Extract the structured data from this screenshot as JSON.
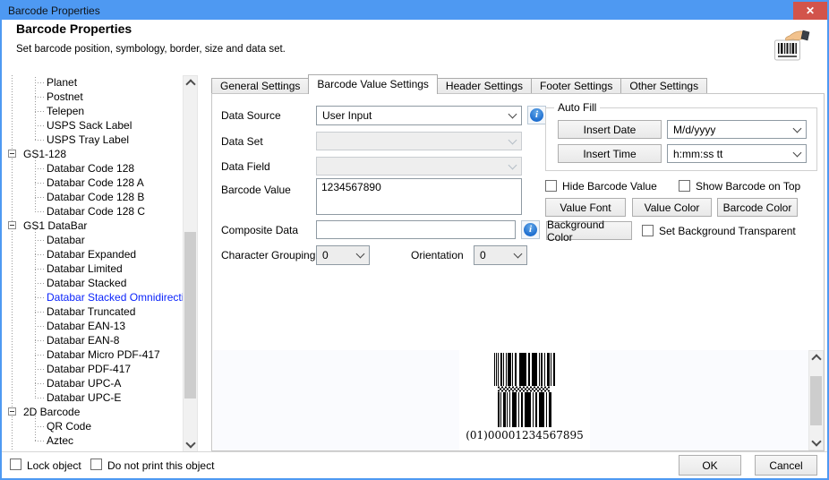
{
  "window": {
    "title": "Barcode Properties",
    "close": "✕"
  },
  "header": {
    "title": "Barcode Properties",
    "subtitle": "Set barcode position, symbology, border, size and data set."
  },
  "tree": {
    "top_children": [
      "Planet",
      "Postnet",
      "Telepen",
      "USPS Sack Label",
      "USPS Tray Label"
    ],
    "groups": [
      {
        "label": "GS1-128",
        "expanded": true,
        "children": [
          "Databar Code 128",
          "Databar Code 128 A",
          "Databar Code 128 B",
          "Databar Code 128 C"
        ]
      },
      {
        "label": "GS1 DataBar",
        "expanded": true,
        "children": [
          "Databar",
          "Databar Expanded",
          "Databar Limited",
          "Databar Stacked",
          "Databar Stacked Omnidirectional",
          "Databar Truncated",
          "Databar EAN-13",
          "Databar EAN-8",
          "Databar Micro PDF-417",
          "Databar PDF-417",
          "Databar UPC-A",
          "Databar UPC-E"
        ]
      },
      {
        "label": "2D Barcode",
        "expanded": true,
        "children": [
          "QR Code",
          "Aztec"
        ]
      }
    ],
    "selected_item": "Databar Stacked Omnidirectional"
  },
  "tabs": {
    "labels": [
      "General Settings",
      "Barcode Value Settings",
      "Header Settings",
      "Footer Settings",
      "Other Settings"
    ],
    "active": "Barcode Value Settings",
    "active_index": 1
  },
  "form": {
    "data_source_label": "Data Source",
    "data_source_value": "User Input",
    "data_set_label": "Data Set",
    "data_set_value": "",
    "data_field_label": "Data Field",
    "data_field_value": "",
    "barcode_value_label": "Barcode Value",
    "barcode_value": "1234567890",
    "composite_data_label": "Composite Data",
    "composite_data_value": "",
    "character_grouping_label": "Character Grouping",
    "character_grouping_value": "0",
    "orientation_label": "Orientation",
    "orientation_value": "0"
  },
  "auto_fill": {
    "title": "Auto Fill",
    "insert_date_label": "Insert Date",
    "date_format_value": "M/d/yyyy",
    "insert_time_label": "Insert Time",
    "time_format_value": "h:mm:ss tt"
  },
  "value_options": {
    "hide_barcode_value_label": "Hide Barcode Value",
    "hide_barcode_value_checked": false,
    "show_barcode_on_top_label": "Show Barcode on Top",
    "show_barcode_on_top_checked": false,
    "value_font_label": "Value Font",
    "value_color_label": "Value Color",
    "barcode_color_label": "Barcode Color",
    "background_color_label": "Background Color",
    "set_background_transparent_label": "Set Background Transparent",
    "set_background_transparent_checked": false
  },
  "preview": {
    "caption": "(01)00001234567895"
  },
  "footer": {
    "lock_object_label": "Lock object",
    "lock_object_checked": false,
    "do_not_print_label": "Do not print this object",
    "do_not_print_checked": false,
    "ok_label": "OK",
    "cancel_label": "Cancel"
  },
  "colors": {
    "titlebar_blue": "#4e99f2",
    "close_red": "#d2544b",
    "tree_selected_text": "#0b24fb",
    "info_icon_blue": "#1f6fd0"
  }
}
